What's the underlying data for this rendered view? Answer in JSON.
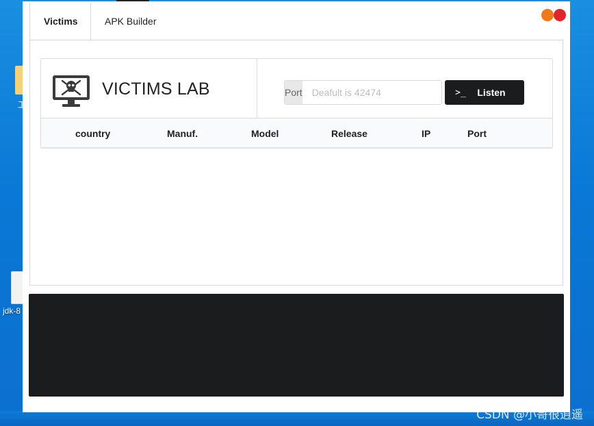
{
  "desktop": {
    "folder_label": "工",
    "jdk_label": "jdk-8",
    "watermark": "CSDN @小哥很逍遥"
  },
  "app": {
    "tabs": [
      {
        "label": "Victims",
        "active": true
      },
      {
        "label": "APK Builder",
        "active": false
      }
    ],
    "lab": {
      "title": "VICTIMS LAB",
      "icon": "monitor-skull-icon",
      "port_label": "Port",
      "port_placeholder": "Deafult is 42474",
      "port_value": "",
      "listen_icon": "terminal-icon",
      "listen_icon_glyph": ">_",
      "listen_label": "Listen"
    },
    "table": {
      "columns": [
        "country",
        "Manuf.",
        "Model",
        "Release",
        "IP",
        "Port"
      ],
      "rows": []
    },
    "console": {
      "text": ""
    }
  },
  "colors": {
    "minimize_dot": "#f07a1a",
    "close_dot": "#e0262b",
    "listen_button": "#1b1c1d",
    "console_bg": "#1b1c1d",
    "desktop_bg": "#0a78d6"
  }
}
